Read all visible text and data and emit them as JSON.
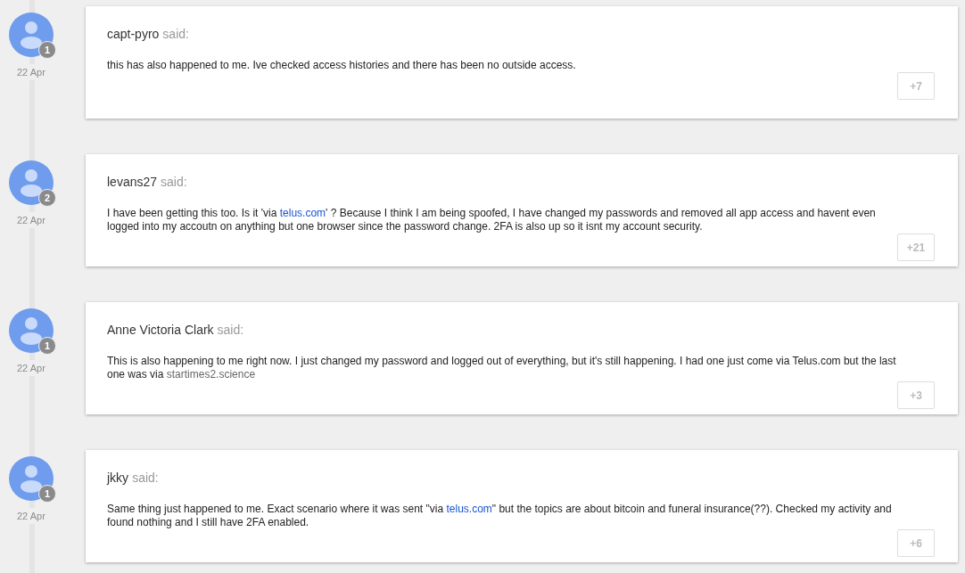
{
  "posts": [
    {
      "author": "capt-pyro",
      "said": "said:",
      "date": "22 Apr",
      "badge": "1",
      "body": [
        {
          "kind": "plain",
          "text": "this has also happened to me. Ive checked access histories and there has been no outside access."
        }
      ],
      "plus": "+7"
    },
    {
      "author": "levans27",
      "said": "said:",
      "date": "22 Apr",
      "badge": "2",
      "body": [
        {
          "kind": "plain",
          "text": "I have been getting this too. Is it 'via "
        },
        {
          "kind": "link",
          "text": "telus.com"
        },
        {
          "kind": "plain",
          "text": "' ? Because I think I am being spoofed, I have changed my passwords and removed all app access and havent even logged into my accoutn on anything but one browser since the password change. 2FA is also up so it isnt my account security."
        }
      ],
      "plus": "+21"
    },
    {
      "author": "Anne Victoria Clark",
      "said": "said:",
      "date": "22 Apr",
      "badge": "1",
      "body": [
        {
          "kind": "plain",
          "text": "This is also happening to me right now. I just changed my password and logged out of everything, but it's still happening. I had one just come via Telus.com but the last one was via "
        },
        {
          "kind": "muted-link",
          "text": "startimes2.science"
        }
      ],
      "plus": "+3"
    },
    {
      "author": "jkky",
      "said": "said:",
      "date": "22 Apr",
      "badge": "1",
      "body": [
        {
          "kind": "plain",
          "text": "Same thing just happened to me. Exact scenario where it was sent \"via "
        },
        {
          "kind": "link",
          "text": "telus.com"
        },
        {
          "kind": "plain",
          "text": "\" but the topics are about bitcoin and funeral insurance(??). Checked my activity and found nothing and I still have 2FA enabled."
        }
      ],
      "plus": "+6"
    }
  ]
}
